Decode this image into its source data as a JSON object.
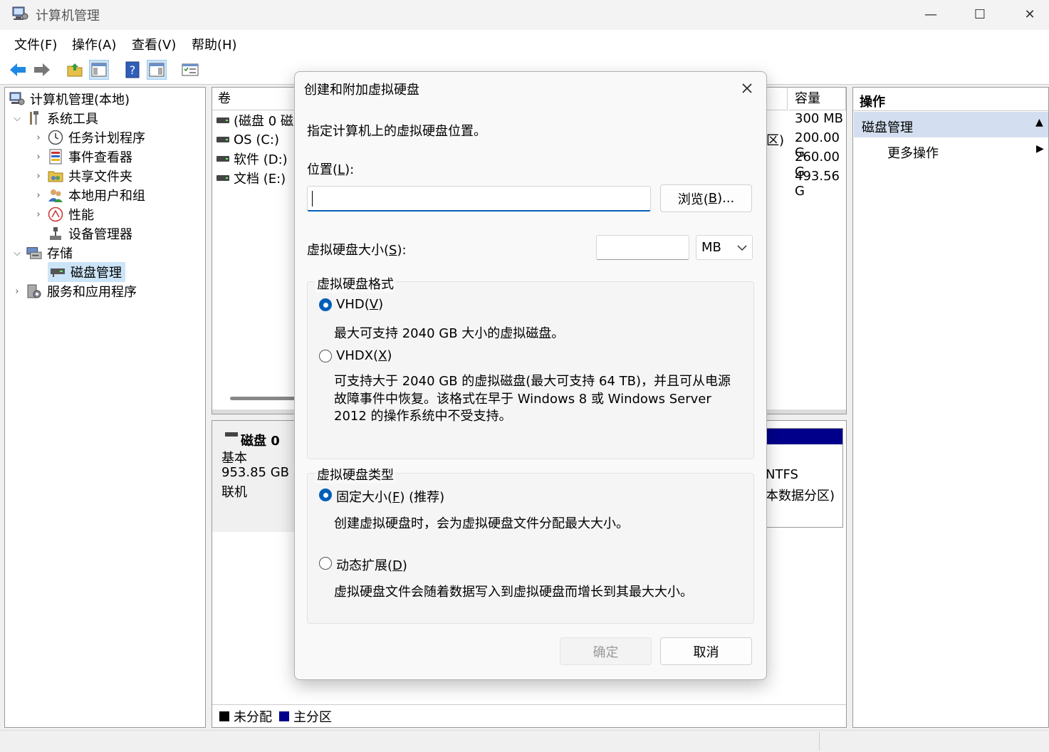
{
  "window": {
    "title": "计算机管理",
    "minimize_glyph": "—",
    "maximize_glyph": "☐",
    "close_glyph": "✕"
  },
  "menu": [
    "文件(F)",
    "操作(A)",
    "查看(V)",
    "帮助(H)"
  ],
  "toolbar": {
    "icons": [
      "back-arrow-icon",
      "forward-arrow-icon",
      "up-folder-icon",
      "show-hide-tree-icon",
      "help-icon",
      "show-hide-action-pane-icon",
      "properties-icon"
    ]
  },
  "tree": {
    "root": "计算机管理(本地)",
    "system_tools": "系统工具",
    "task_scheduler": "任务计划程序",
    "event_viewer": "事件查看器",
    "shared_folders": "共享文件夹",
    "local_users": "本地用户和组",
    "performance": "性能",
    "device_manager": "设备管理器",
    "storage": "存储",
    "disk_management": "磁盘管理",
    "services_apps": "服务和应用程序"
  },
  "volumes": {
    "col_volume": "卷",
    "col_capacity": "容量",
    "rows": [
      {
        "name": "(磁盘 0 磁盘",
        "capacity": "300 MB",
        "extra": ""
      },
      {
        "name": "OS (C:)",
        "capacity": "200.00 G",
        "extra": "区)"
      },
      {
        "name": "软件 (D:)",
        "capacity": "260.00 G",
        "extra": ""
      },
      {
        "name": "文档 (E:)",
        "capacity": "493.56 G",
        "extra": ""
      }
    ]
  },
  "disk": {
    "name": "磁盘 0",
    "type": "基本",
    "size": "953.85 GB",
    "status": "联机",
    "part_fs": "NTFS",
    "part_desc": "本数据分区)"
  },
  "legend": {
    "unallocated": "未分配",
    "primary": "主分区",
    "unallocated_color": "#000000",
    "primary_color": "#00008b"
  },
  "actions": {
    "header": "操作",
    "section": "磁盘管理",
    "more": "更多操作"
  },
  "dialog": {
    "title": "创建和附加虚拟硬盘",
    "instruction": "指定计算机上的虚拟硬盘位置。",
    "location_label_pre": "位置(",
    "location_label_key": "L",
    "location_label_post": "):",
    "location_value": "",
    "browse_pre": "浏览(",
    "browse_key": "B",
    "browse_post": ")...",
    "size_label_pre": "虚拟硬盘大小(",
    "size_label_key": "S",
    "size_label_post": "):",
    "size_value": "",
    "size_unit": "MB",
    "format_group": "虚拟硬盘格式",
    "vhd_pre": "VHD(",
    "vhd_key": "V",
    "vhd_post": ")",
    "vhd_desc": "最大可支持 2040 GB 大小的虚拟磁盘。",
    "vhdx_pre": "VHDX(",
    "vhdx_key": "X",
    "vhdx_post": ")",
    "vhdx_desc": "可支持大于 2040 GB 的虚拟磁盘(最大可支持 64 TB)，并且可从电源故障事件中恢复。该格式在早于 Windows 8 或 Windows Server 2012 的操作系统中不受支持。",
    "type_group": "虚拟硬盘类型",
    "fixed_pre": "固定大小(",
    "fixed_key": "F",
    "fixed_post": ") (推荐)",
    "fixed_desc": "创建虚拟硬盘时，会为虚拟硬盘文件分配最大大小。",
    "dynamic_pre": "动态扩展(",
    "dynamic_key": "D",
    "dynamic_post": ")",
    "dynamic_desc": "虚拟硬盘文件会随着数据写入到虚拟硬盘而增长到其最大大小。",
    "ok": "确定",
    "cancel": "取消",
    "format_selected": "VHD",
    "type_selected": "固定大小"
  },
  "colors": {
    "accent": "#005fb8",
    "selection": "#cce4f7"
  }
}
